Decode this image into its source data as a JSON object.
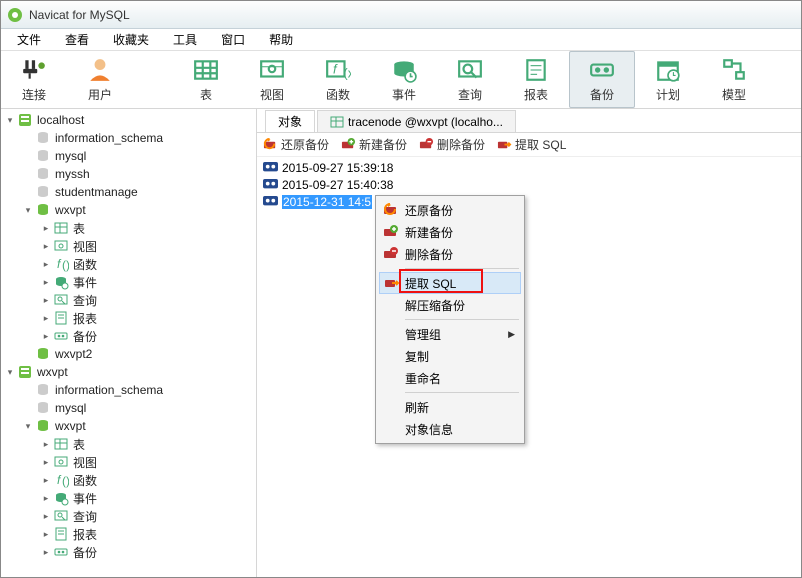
{
  "app": {
    "title": "Navicat for MySQL"
  },
  "menu": [
    "文件",
    "查看",
    "收藏夹",
    "工具",
    "窗口",
    "帮助"
  ],
  "toolbar": [
    {
      "key": "connect",
      "label": "连接"
    },
    {
      "key": "user",
      "label": "用户"
    },
    {
      "key": "table",
      "label": "表"
    },
    {
      "key": "view",
      "label": "视图"
    },
    {
      "key": "function",
      "label": "函数"
    },
    {
      "key": "event",
      "label": "事件"
    },
    {
      "key": "query",
      "label": "查询"
    },
    {
      "key": "report",
      "label": "报表"
    },
    {
      "key": "backup",
      "label": "备份",
      "active": true
    },
    {
      "key": "schedule",
      "label": "计划"
    },
    {
      "key": "model",
      "label": "模型"
    }
  ],
  "tree": [
    {
      "level": 0,
      "exp": "open",
      "icon": "server-on",
      "label": "localhost"
    },
    {
      "level": 1,
      "exp": "",
      "icon": "db-off",
      "label": "information_schema"
    },
    {
      "level": 1,
      "exp": "",
      "icon": "db-off",
      "label": "mysql"
    },
    {
      "level": 1,
      "exp": "",
      "icon": "db-off",
      "label": "myssh"
    },
    {
      "level": 1,
      "exp": "",
      "icon": "db-off",
      "label": "studentmanage"
    },
    {
      "level": 1,
      "exp": "open",
      "icon": "db-on",
      "label": "wxvpt"
    },
    {
      "level": 2,
      "exp": "closed",
      "icon": "table",
      "label": "表"
    },
    {
      "level": 2,
      "exp": "closed",
      "icon": "view",
      "label": "视图"
    },
    {
      "level": 2,
      "exp": "closed",
      "icon": "func",
      "label": "函数"
    },
    {
      "level": 2,
      "exp": "closed",
      "icon": "event",
      "label": "事件"
    },
    {
      "level": 2,
      "exp": "closed",
      "icon": "query",
      "label": "查询"
    },
    {
      "level": 2,
      "exp": "closed",
      "icon": "report",
      "label": "报表"
    },
    {
      "level": 2,
      "exp": "closed",
      "icon": "backup",
      "label": "备份"
    },
    {
      "level": 1,
      "exp": "",
      "icon": "db-on",
      "label": "wxvpt2"
    },
    {
      "level": 0,
      "exp": "open",
      "icon": "server-on",
      "label": "wxvpt"
    },
    {
      "level": 1,
      "exp": "",
      "icon": "db-off",
      "label": "information_schema"
    },
    {
      "level": 1,
      "exp": "",
      "icon": "db-off",
      "label": "mysql"
    },
    {
      "level": 1,
      "exp": "open",
      "icon": "db-on",
      "label": "wxvpt"
    },
    {
      "level": 2,
      "exp": "closed",
      "icon": "table",
      "label": "表"
    },
    {
      "level": 2,
      "exp": "closed",
      "icon": "view",
      "label": "视图"
    },
    {
      "level": 2,
      "exp": "closed",
      "icon": "func",
      "label": "函数"
    },
    {
      "level": 2,
      "exp": "closed",
      "icon": "event",
      "label": "事件"
    },
    {
      "level": 2,
      "exp": "closed",
      "icon": "query",
      "label": "查询"
    },
    {
      "level": 2,
      "exp": "closed",
      "icon": "report",
      "label": "报表"
    },
    {
      "level": 2,
      "exp": "closed",
      "icon": "backup",
      "label": "备份"
    }
  ],
  "tabs": {
    "object": "对象",
    "trace": "tracenode @wxvpt (localho..."
  },
  "actions": {
    "restore": "还原备份",
    "new": "新建备份",
    "delete": "删除备份",
    "extract": "提取 SQL"
  },
  "backups": [
    {
      "ts": "2015-09-27 15:39:18",
      "selected": false
    },
    {
      "ts": "2015-09-27 15:40:38",
      "selected": false
    },
    {
      "ts": "2015-12-31 14:5",
      "selected": true
    }
  ],
  "context_menu": {
    "restore": "还原备份",
    "new": "新建备份",
    "delete": "删除备份",
    "extract": "提取 SQL",
    "decompress": "解压缩备份",
    "manage_group": "管理组",
    "copy": "复制",
    "rename": "重命名",
    "refresh": "刷新",
    "object_info": "对象信息"
  }
}
